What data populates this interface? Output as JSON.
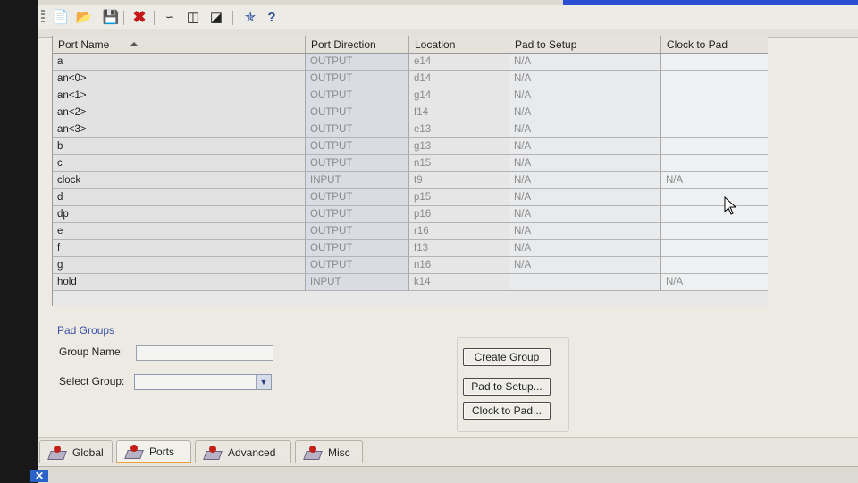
{
  "toolbar": {
    "icons": [
      "new-file-icon",
      "open-folder-icon",
      "save-icon",
      "delete-icon",
      "waveform-icon",
      "add-port-icon",
      "remove-port-icon",
      "tool-icon",
      "context-help-icon"
    ],
    "menu_fragment": "Help"
  },
  "table": {
    "columns": [
      "Port Name",
      "Port Direction",
      "Location",
      "Pad to Setup",
      "Clock to Pad"
    ],
    "rows": [
      [
        "a",
        "OUTPUT",
        "e14",
        "N/A",
        ""
      ],
      [
        "an<0>",
        "OUTPUT",
        "d14",
        "N/A",
        ""
      ],
      [
        "an<1>",
        "OUTPUT",
        "g14",
        "N/A",
        ""
      ],
      [
        "an<2>",
        "OUTPUT",
        "f14",
        "N/A",
        ""
      ],
      [
        "an<3>",
        "OUTPUT",
        "e13",
        "N/A",
        ""
      ],
      [
        "b",
        "OUTPUT",
        "g13",
        "N/A",
        ""
      ],
      [
        "c",
        "OUTPUT",
        "n15",
        "N/A",
        ""
      ],
      [
        "clock",
        "INPUT",
        "t9",
        "N/A",
        "N/A"
      ],
      [
        "d",
        "OUTPUT",
        "p15",
        "N/A",
        ""
      ],
      [
        "dp",
        "OUTPUT",
        "p16",
        "N/A",
        ""
      ],
      [
        "e",
        "OUTPUT",
        "r16",
        "N/A",
        ""
      ],
      [
        "f",
        "OUTPUT",
        "f13",
        "N/A",
        ""
      ],
      [
        "g",
        "OUTPUT",
        "n16",
        "N/A",
        ""
      ],
      [
        "hold",
        "INPUT",
        "k14",
        "",
        "N/A"
      ]
    ]
  },
  "pad_groups": {
    "title": "Pad Groups",
    "group_name_label": "Group Name:",
    "group_name_value": "",
    "select_group_label": "Select Group:",
    "select_group_value": "",
    "create_group": "Create Group",
    "pad_to_setup": "Pad to Setup...",
    "clock_to_pad": "Clock to Pad..."
  },
  "tabs": [
    "Global",
    "Ports",
    "Advanced",
    "Misc"
  ],
  "active_tab": "Ports"
}
